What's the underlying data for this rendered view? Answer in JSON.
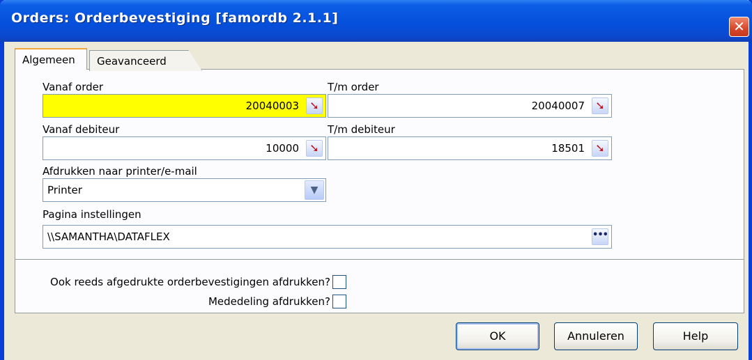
{
  "window": {
    "title": "Orders: Orderbevestiging [famordb 2.1.1]",
    "close_glyph": "✕"
  },
  "tabs": [
    {
      "label": "Algemeen",
      "active": true
    },
    {
      "label": "Geavanceerd",
      "active": false
    }
  ],
  "form": {
    "vanaf_order": {
      "label": "Vanaf order",
      "value": "20040003",
      "highlight": "#ffff00"
    },
    "tm_order": {
      "label": "T/m order",
      "value": "20040007"
    },
    "vanaf_debiteur": {
      "label": "Vanaf debiteur",
      "value": "10000"
    },
    "tm_debiteur": {
      "label": "T/m debiteur",
      "value": "18501"
    },
    "printer": {
      "label": "Afdrukken naar printer/e-mail",
      "value": "Printer"
    },
    "pagina": {
      "label": "Pagina instellingen",
      "value": "\\\\SAMANTHA\\DATAFLEX"
    }
  },
  "options": {
    "reeds_afgedrukt": {
      "label": "Ook reeds afgedrukte orderbevestigingen afdrukken?",
      "checked": false
    },
    "mededeling": {
      "label": "Mededeling afdrukken?",
      "checked": false
    }
  },
  "buttons": {
    "ok": "OK",
    "annuleren": "Annuleren",
    "help": "Help"
  },
  "icons": {
    "lookup": "arrow-lookup-icon",
    "dropdown": "chevron-down-icon",
    "ellipsis": "ellipsis-icon"
  },
  "colors": {
    "title_bar": "#0550dc",
    "close": "#d8462a",
    "active_tab_accent": "#f3a43c"
  }
}
